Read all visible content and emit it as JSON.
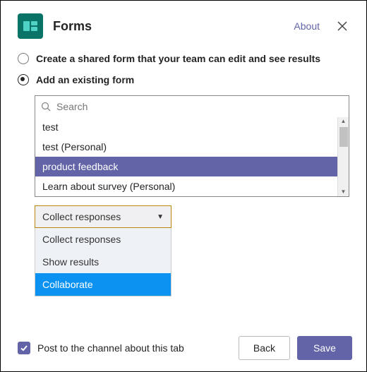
{
  "header": {
    "app_name": "Forms",
    "about_label": "About"
  },
  "options": {
    "create_new_label": "Create a shared form that your team can edit and see results",
    "add_existing_label": "Add an existing form",
    "selected": "add_existing"
  },
  "search": {
    "placeholder": "Search",
    "value": ""
  },
  "form_list": {
    "items": [
      {
        "label": "test",
        "selected": false
      },
      {
        "label": "test (Personal)",
        "selected": false
      },
      {
        "label": "product feedback",
        "selected": true
      },
      {
        "label": "Learn about survey (Personal)",
        "selected": false
      }
    ]
  },
  "action_select": {
    "current": "Collect responses",
    "options": [
      {
        "label": "Collect responses",
        "highlight": false
      },
      {
        "label": "Show results",
        "highlight": false
      },
      {
        "label": "Collaborate",
        "highlight": true
      }
    ]
  },
  "footer": {
    "post_label": "Post to the channel about this tab",
    "post_checked": true,
    "back_label": "Back",
    "save_label": "Save"
  },
  "colors": {
    "brand": "#6264a7",
    "app_icon_bg": "#0a7368",
    "select_border": "#b8860b",
    "option_highlight": "#0c93f2"
  }
}
